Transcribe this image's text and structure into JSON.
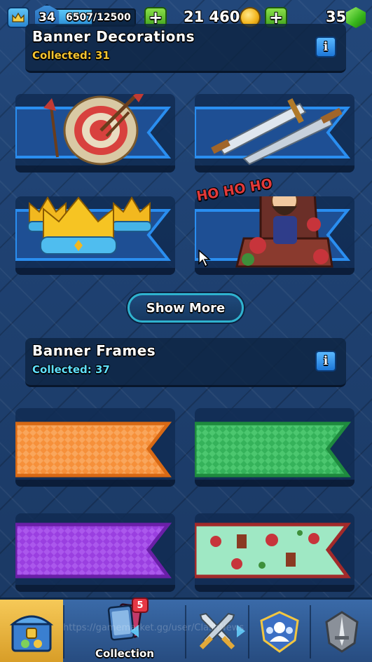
{
  "top_bar": {
    "level": "34",
    "xp": "6507/12500",
    "xp_fraction": 0.52,
    "gold": "21 460",
    "gems": "35"
  },
  "decorations": {
    "title": "Banner Decorations",
    "collected": "Collected: 31",
    "count_color": "#f5c531",
    "items": [
      {
        "name": "target-with-arrows"
      },
      {
        "name": "crossed-swords"
      },
      {
        "name": "golden-crowns"
      },
      {
        "name": "king-ho-ho-ho",
        "text": "HO HO HO"
      }
    ],
    "show_more_label": "Show More"
  },
  "frames": {
    "title": "Banner Frames",
    "collected": "Collected: 37",
    "count_color": "#5fe0ff",
    "items": [
      {
        "name": "orange-frame",
        "color": "#f6903a"
      },
      {
        "name": "green-frame",
        "color": "#35b25a"
      },
      {
        "name": "purple-frame",
        "color": "#9a3fe0"
      },
      {
        "name": "festive-frame",
        "color": "#7fe0b0"
      }
    ]
  },
  "bottom_nav": {
    "collection_label": "Collection",
    "new_badge": "5",
    "icons": [
      "chest-icon",
      "cards-icon",
      "battle-swords-icon",
      "clan-icon",
      "tournament-icon"
    ]
  },
  "watermark": "https://gamemarket.gg/user/ClashNews"
}
